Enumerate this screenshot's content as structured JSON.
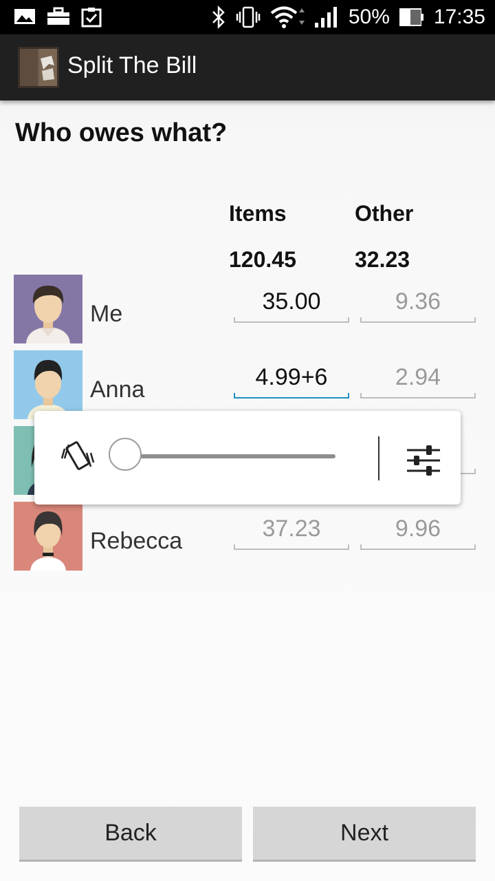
{
  "status_bar": {
    "battery": "50%",
    "time": "17:35",
    "icons": [
      "gallery-icon",
      "briefcase-icon",
      "clipboard-check-icon",
      "bluetooth-icon",
      "vibrate-icon",
      "wifi-icon",
      "signal-icon",
      "battery-icon"
    ]
  },
  "app": {
    "title": "Split The Bill"
  },
  "page": {
    "heading": "Who owes what?"
  },
  "columns": {
    "items": {
      "label": "Items",
      "total": "120.45"
    },
    "other": {
      "label": "Other",
      "total": "32.23"
    }
  },
  "people": [
    {
      "name": "Me",
      "items": "35.00",
      "other": "9.36"
    },
    {
      "name": "Anna",
      "items": "4.99+6",
      "other": "2.94"
    },
    {
      "name": "",
      "items": "",
      "other": ""
    },
    {
      "name": "Rebecca",
      "items": "37.23",
      "other": "9.96"
    }
  ],
  "volume_popup": {
    "level": 0,
    "icons": [
      "vibrate-icon",
      "sliders-icon"
    ]
  },
  "buttons": {
    "back": "Back",
    "next": "Next"
  },
  "colors": {
    "accent": "#1f8fc4",
    "action_bar": "#202020",
    "button": "#d6d6d6"
  }
}
